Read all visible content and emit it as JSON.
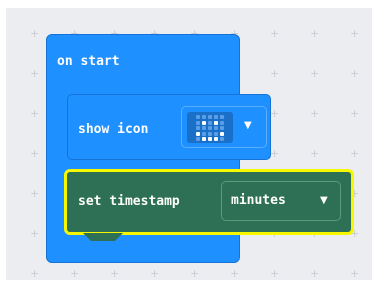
{
  "blocks": {
    "on_start": {
      "label": "on start",
      "color": "#1e90ff"
    },
    "show_icon": {
      "label": "show icon",
      "icon": "smiley-led-icon",
      "color": "#1e90ff"
    },
    "set_timestamp": {
      "label": "set timestamp",
      "unit": "minutes",
      "color": "#2e7055",
      "highlight_color": "#f7f700"
    }
  }
}
